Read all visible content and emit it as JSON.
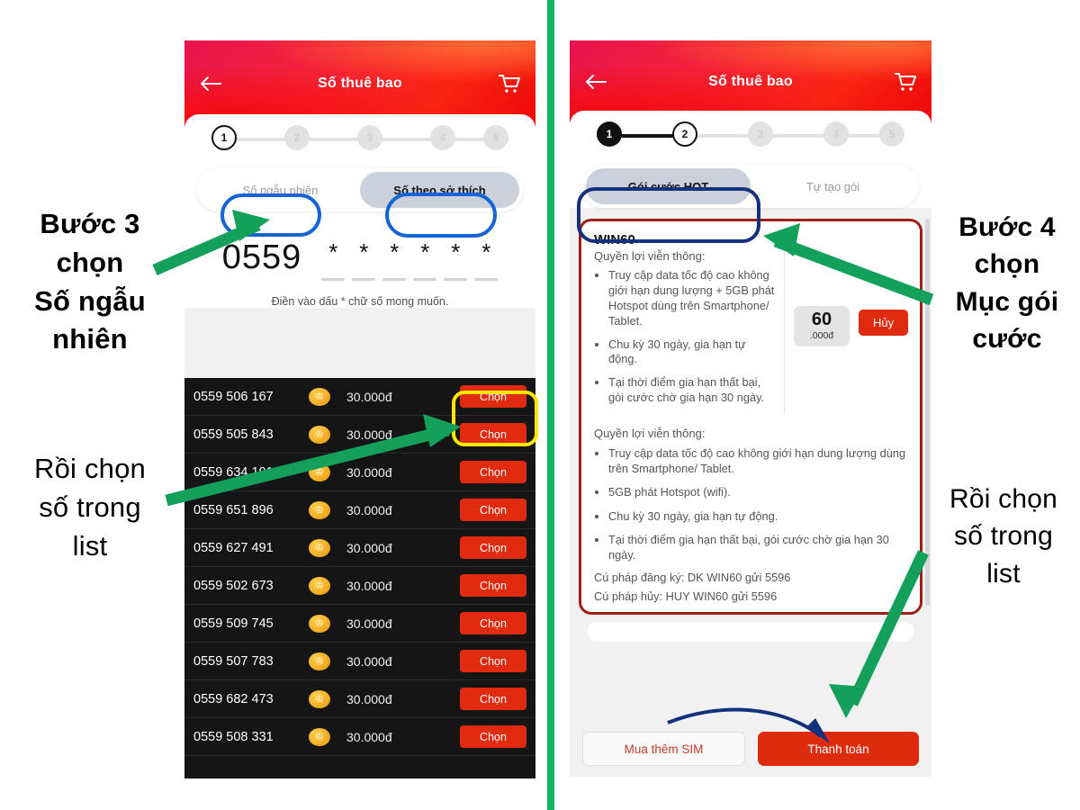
{
  "meta": {
    "accent_red": "#e02b11",
    "green": "#10b861",
    "blue": "#1464d6",
    "yellow": "#ffe800"
  },
  "left_phone": {
    "header": {
      "title": "Số thuê bao",
      "back_icon": "arrow-left-icon",
      "cart_icon": "shopping-cart-icon"
    },
    "stepper": {
      "steps": [
        "1",
        "2",
        "3",
        "4",
        "5"
      ],
      "current": 1
    },
    "tabs": [
      {
        "label": "Số ngẫu nhiên",
        "active": false
      },
      {
        "label": "Số theo sở thích",
        "active": true
      }
    ],
    "number_entry": {
      "prefix": "0559",
      "stars": [
        "*",
        "*",
        "*",
        "*",
        "*",
        "*"
      ],
      "hint": "Điền vào dấu * chữ số mong muốn."
    },
    "list": {
      "price_unit": "30.000đ",
      "action_label": "Chọn",
      "badge_icon": "crown-icon",
      "rows": [
        {
          "number": "0559 506 167",
          "price": "30.000đ",
          "action": "Chọn"
        },
        {
          "number": "0559 505 843",
          "price": "30.000đ",
          "action": "Chọn"
        },
        {
          "number": "0559 634 191",
          "price": "30.000đ",
          "action": "Chọn"
        },
        {
          "number": "0559 651 896",
          "price": "30.000đ",
          "action": "Chọn"
        },
        {
          "number": "0559 627 491",
          "price": "30.000đ",
          "action": "Chọn"
        },
        {
          "number": "0559 502 673",
          "price": "30.000đ",
          "action": "Chọn"
        },
        {
          "number": "0559 509 745",
          "price": "30.000đ",
          "action": "Chọn"
        },
        {
          "number": "0559 507 783",
          "price": "30.000đ",
          "action": "Chọn"
        },
        {
          "number": "0559 682 473",
          "price": "30.000đ",
          "action": "Chọn"
        },
        {
          "number": "0559 508 331",
          "price": "30.000đ",
          "action": "Chọn"
        }
      ]
    }
  },
  "right_phone": {
    "header": {
      "title": "Số thuê bao",
      "back_icon": "arrow-left-icon",
      "cart_icon": "shopping-cart-icon"
    },
    "stepper": {
      "steps": [
        "1",
        "2",
        "3",
        "4",
        "5"
      ],
      "current": 2
    },
    "tabs": [
      {
        "label": "Gói cước HOT",
        "active": true
      },
      {
        "label": "Tự tạo gói",
        "active": false
      }
    ],
    "package": {
      "name": "WIN60",
      "benefits_heading": "Quyền lợi viễn thông:",
      "benefits_short": [
        "Truy cập data tốc độ cao không giới hạn dung lượng + 5GB phát Hotspot dùng trên Smartphone/ Tablet.",
        "Chu kỳ 30 ngày, gia hạn tự động.",
        "Tại thời điểm gia hạn thất bại, gói cước chờ gia hạn 30 ngày."
      ],
      "price_major": "60",
      "price_minor": ".000đ",
      "cancel_label": "Hủy",
      "detail_heading": "Quyền lợi viễn thông:",
      "benefits_long": [
        "Truy cập data tốc độ cao không giới hạn dung lượng dùng trên Smartphone/ Tablet.",
        "5GB phát Hotspot (wifi).",
        "Chu kỳ 30 ngày, gia hạn tự động.",
        "Tại thời điểm gia hạn thất bại, gói cước chờ gia hạn 30 ngày."
      ],
      "register_syntax": "Cú pháp đăng ký: DK WIN60 gửi 5596",
      "cancel_syntax": "Cú pháp hủy: HUY WIN60 gửi 5596"
    },
    "footer": {
      "secondary_label": "Mua thêm SIM",
      "primary_label": "Thanh toán"
    }
  },
  "annotations": {
    "left_top": {
      "l1": "Bước 3",
      "l2": "chọn",
      "l3": "Số ngẫu",
      "l4": "nhiên"
    },
    "left_bottom": {
      "l1": "Rồi  chọn",
      "l2": "số trong",
      "l3": "list"
    },
    "right_top": {
      "l1": "Bước 4",
      "l2": "chọn",
      "l3": "Mục gói",
      "l4": "cước"
    },
    "right_bottom": {
      "l1": "Rồi  chọn",
      "l2": "số trong",
      "l3": "list"
    }
  }
}
